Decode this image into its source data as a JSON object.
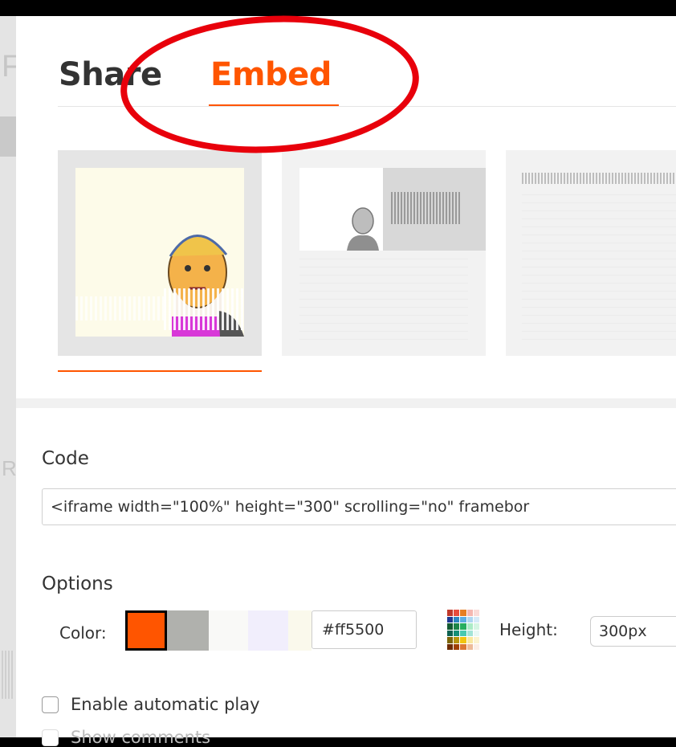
{
  "tabs": {
    "share_label": "Share",
    "embed_label": "Embed",
    "active": "Embed"
  },
  "backdrop": {
    "letter_top": "F",
    "letter_mid": "R"
  },
  "code_section": {
    "title": "Code",
    "value": "<iframe width=\"100%\" height=\"300\" scrolling=\"no\" framebor"
  },
  "options": {
    "title": "Options",
    "color_label": "Color:",
    "swatches": [
      "#ff5500",
      "#b0b1ad",
      "#f9f9f7",
      "#f1eefc",
      "#faf9ec"
    ],
    "selected_color": "#ff5500",
    "hex_value": "#ff5500",
    "height_label": "Height:",
    "height_value": "300px",
    "autoplay_label": "Enable automatic play",
    "autoplay_checked": false,
    "comments_label": "Show comments",
    "comments_checked": false
  },
  "colors": {
    "accent": "#ff5500",
    "annotation": "#e8000b"
  }
}
